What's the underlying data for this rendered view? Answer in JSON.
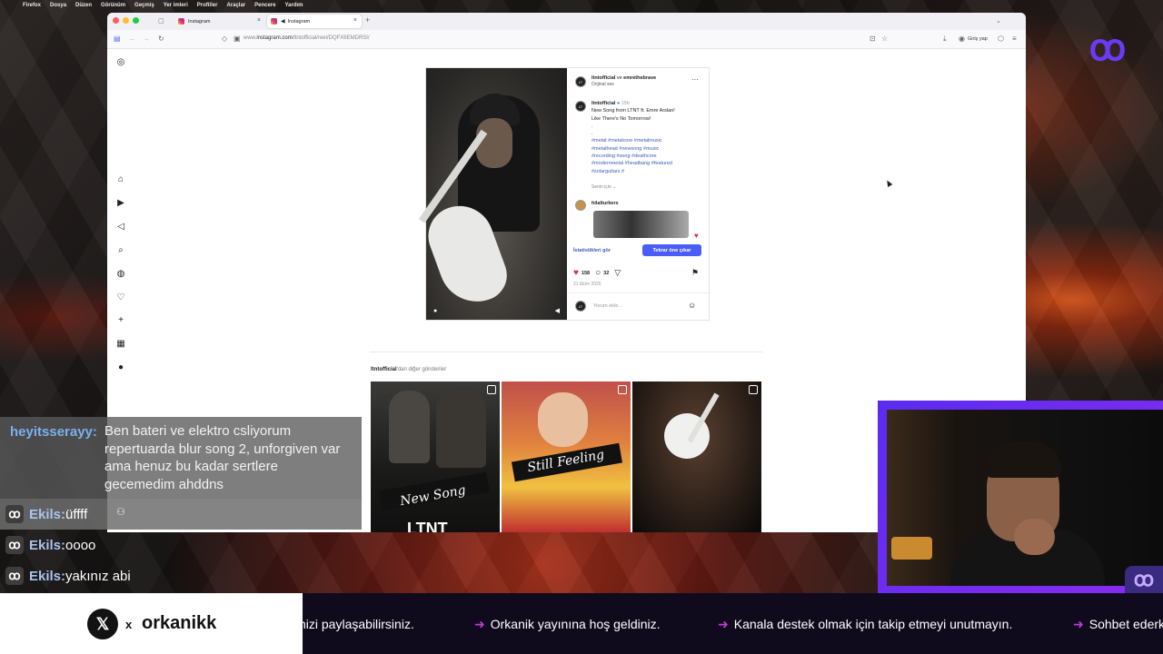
{
  "menubar": [
    "Firefox",
    "Dosya",
    "Düzen",
    "Görünüm",
    "Geçmiş",
    "Yer imleri",
    "Profiller",
    "Araçlar",
    "Pencere",
    "Yardım"
  ],
  "browser": {
    "tabs": [
      {
        "label": "Instagram",
        "active": false
      },
      {
        "label": "Instagram",
        "active": true
      }
    ],
    "new_tab": "+",
    "url_prefix": "www.",
    "url_domain": "instagram.com",
    "url_path": "/ltntofficial/reel/DQFX6EMDRSI/",
    "login_label": "Giriş yap"
  },
  "post": {
    "author": "ltntofficial",
    "connector": "ve",
    "coauthor": "emrethebrave",
    "audio": "Orijinal ses",
    "caption_author": "ltntofficial",
    "caption_time": "15h",
    "caption_line1": "New Song from LTNT ft. Emre Arslan!",
    "caption_line2": "Like There's No Tomorrow!",
    "dots": ".",
    "hashtags": [
      "#metal #metalcore #metalmusic",
      "#metalhead #newsong #music",
      "#recording #song #deathcore",
      "#modernmetal #headbang #featured",
      "#solarguitars #"
    ],
    "for_you": "Senin için",
    "commenter": "hilalturkerx",
    "stats_link": "İstatistikleri gör",
    "boost_button": "Tekrar öne çıkar",
    "likes": "158",
    "comments": "32",
    "date": "21 Ekim 2025",
    "comment_placeholder": "Yorum ekle..."
  },
  "more_posts": {
    "prefix": "ltntofficial",
    "suffix": "'dan diğer gönderiler",
    "thumbs": [
      {
        "script": "New Song",
        "extra": "LTNT"
      },
      {
        "script": "Still Feeling"
      },
      {
        "script": ""
      }
    ]
  },
  "chat": {
    "main": {
      "user": "heyitsserayy:",
      "lines": [
        "Ben bateri ve elektro csliyorum",
        "repertuarda blur song 2, unforgiven var",
        "ama henuz bu kadar sertlere",
        "gecemedim ahddns"
      ]
    },
    "messages": [
      {
        "user": "Ekils:",
        "text": "üffff"
      },
      {
        "user": "Ekils:",
        "text": "oooo"
      },
      {
        "user": "Ekils:",
        "text": "yakınız abi"
      }
    ]
  },
  "ticker": {
    "social_prefix": "x",
    "handle": "orkanikk",
    "items": [
      "nizi paylaşabilirsiniz.",
      "Orkanik yayınına hoş geldiniz.",
      "Kanala destek olmak için takip etmeyi unutmayın.",
      "Sohbet ederk"
    ]
  },
  "logo_text": "ꝏ"
}
